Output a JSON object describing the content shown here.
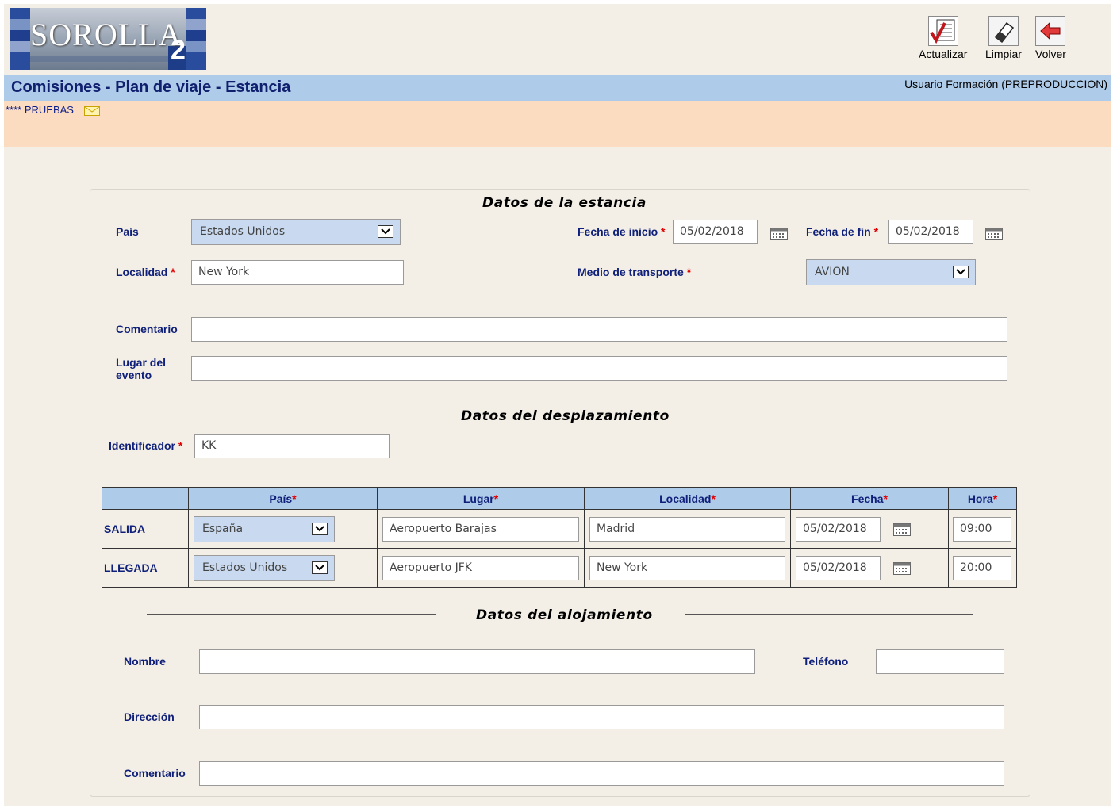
{
  "header": {
    "logo_text": "SOROLLA",
    "logo_suffix": "2",
    "toolbar": {
      "update_label": "Actualizar",
      "clear_label": "Limpiar",
      "back_label": "Volver"
    },
    "page_title": "Comisiones - Plan de viaje - Estancia",
    "user": "Usuario Formación (PREPRODUCCION)",
    "notice": "**** PRUEBAS"
  },
  "stay": {
    "section_title": "Datos de la estancia",
    "country_label": "País",
    "country_value": "Estados Unidos",
    "start_date_label": "Fecha de inicio",
    "start_date_value": "05/02/2018",
    "end_date_label": "Fecha de fin",
    "end_date_value": "05/02/2018",
    "city_label": "Localidad",
    "city_value": "New York",
    "transport_label": "Medio de transporte",
    "transport_value": "AVION",
    "comment_label": "Comentario",
    "comment_value": "",
    "event_place_label_1": "Lugar del",
    "event_place_label_2": "evento",
    "event_place_value": "",
    "required_mark": "*"
  },
  "trip": {
    "section_title": "Datos del desplazamiento",
    "id_label": "Identificador",
    "id_value": "KK",
    "columns": [
      "País",
      "Lugar",
      "Localidad",
      "Fecha",
      "Hora"
    ],
    "rows": [
      {
        "type": "SALIDA",
        "country": "España",
        "place": "Aeropuerto Barajas",
        "city": "Madrid",
        "date": "05/02/2018",
        "time": "09:00"
      },
      {
        "type": "LLEGADA",
        "country": "Estados Unidos",
        "place": "Aeropuerto JFK",
        "city": "New York",
        "date": "05/02/2018",
        "time": "20:00"
      }
    ]
  },
  "lodging": {
    "section_title": "Datos del alojamiento",
    "name_label": "Nombre",
    "name_value": "",
    "phone_label": "Teléfono",
    "phone_value": "",
    "address_label": "Dirección",
    "address_value": "",
    "comment_label": "Comentario",
    "comment_value": ""
  },
  "icons": [
    "logo",
    "update-icon",
    "eraser-icon",
    "back-arrow-icon",
    "mail-icon",
    "calendar-icon",
    "chevron-down-icon"
  ]
}
